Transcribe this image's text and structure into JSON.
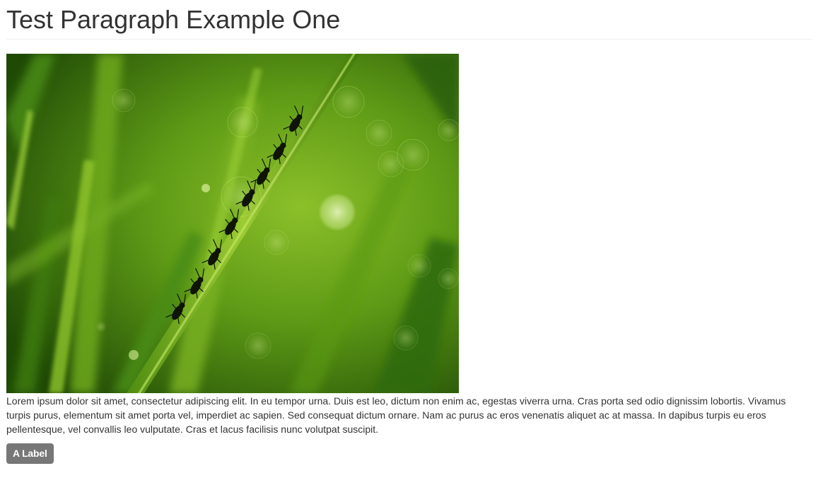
{
  "header": {
    "title": "Test Paragraph Example One"
  },
  "image": {
    "subject": "ants-on-grass-blade-photo",
    "colors": {
      "dark_green": "#1f4a06",
      "mid_green": "#5e9a16",
      "light_green": "#9ccb33",
      "ant": "#0e1506"
    }
  },
  "content": {
    "paragraph": "Lorem ipsum dolor sit amet, consectetur adipiscing elit. In eu tempor urna. Duis est leo, dictum non enim ac, egestas viverra urna. Cras porta sed odio dignissim lobortis. Vivamus turpis purus, elementum sit amet porta vel, imperdiet ac sapien. Sed consequat dictum ornare. Nam ac purus ac eros venenatis aliquet ac at massa. In dapibus turpis eu eros pellentesque, vel convallis leo vulputate. Cras et lacus facilisis nunc volutpat suscipit.",
    "label": "A Label"
  }
}
